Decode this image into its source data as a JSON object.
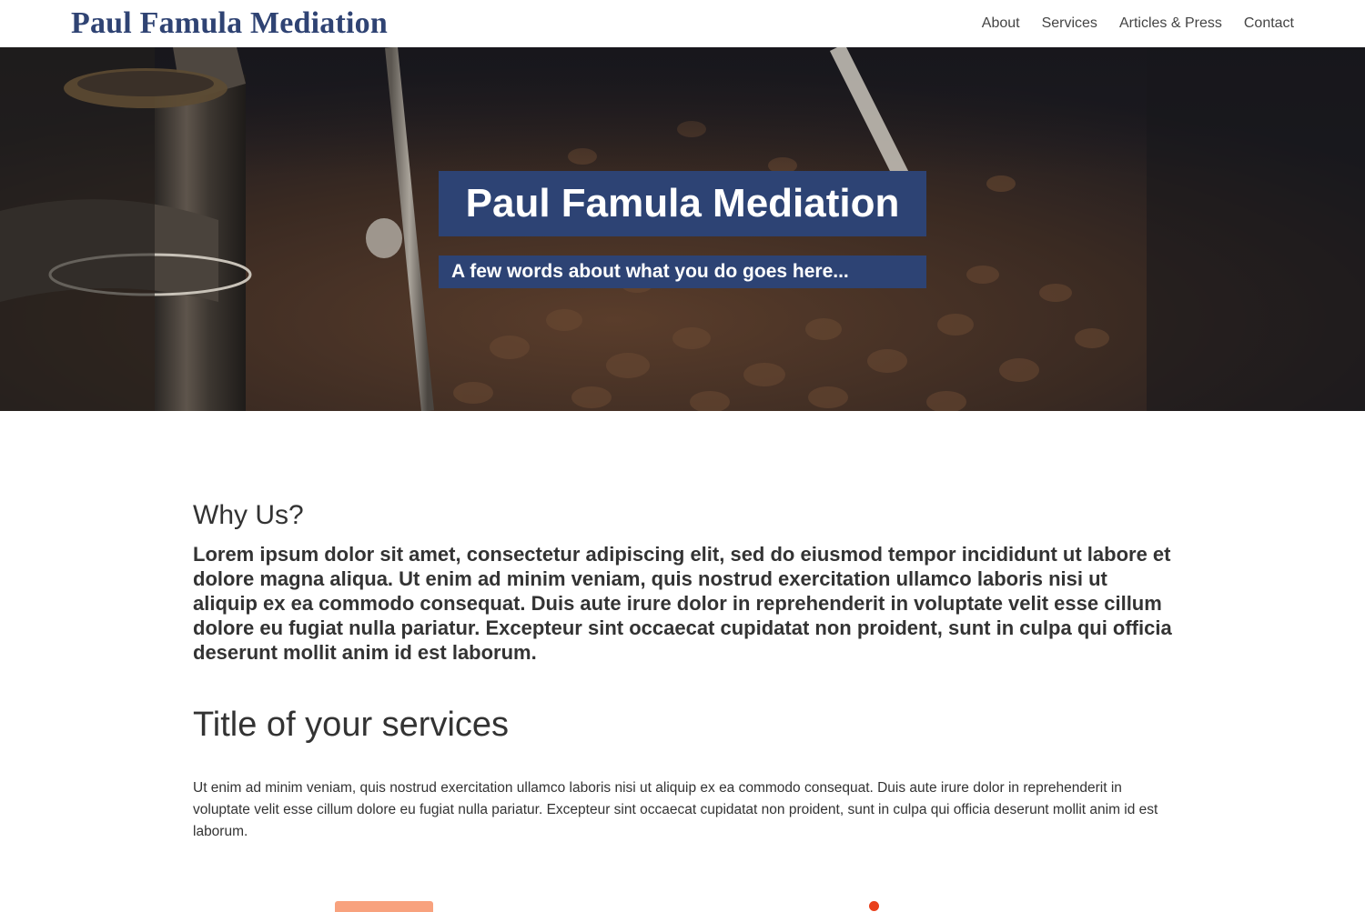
{
  "header": {
    "site_title": "Paul Famula Mediation",
    "nav": [
      {
        "label": "About"
      },
      {
        "label": "Services"
      },
      {
        "label": "Articles & Press"
      },
      {
        "label": "Contact"
      }
    ]
  },
  "hero": {
    "title": "Paul Famula Mediation",
    "subtitle": "A few words about what you do goes here..."
  },
  "why": {
    "heading": "Why Us?",
    "body": "Lorem ipsum dolor sit amet, consectetur adipiscing elit, sed do eiusmod tempor incididunt ut labore et dolore magna aliqua. Ut enim ad minim veniam, quis nostrud exercitation ullamco laboris nisi ut aliquip ex ea commodo consequat. Duis aute irure dolor in reprehenderit in voluptate velit esse cillum dolore eu fugiat nulla pariatur. Excepteur sint occaecat cupidatat non proident, sunt in culpa qui officia deserunt mollit anim id est laborum."
  },
  "services": {
    "heading": "Title of your services",
    "body": "Ut enim ad minim veniam, quis nostrud exercitation ullamco laboris nisi ut aliquip ex ea commodo consequat. Duis aute irure dolor in reprehenderit in voluptate velit esse cillum dolore eu fugiat nulla pariatur. Excepteur sint occaecat cupidatat non proident, sunt in culpa qui officia deserunt mollit anim id est laborum."
  },
  "colors": {
    "brand": "#2f4373",
    "hero_box": "#2d4374",
    "illustration_peach": "#f8a27e",
    "illustration_orange": "#e9401c"
  },
  "icons": [
    "coffee-roaster-photo",
    "cup-illustration",
    "dot-illustration"
  ]
}
